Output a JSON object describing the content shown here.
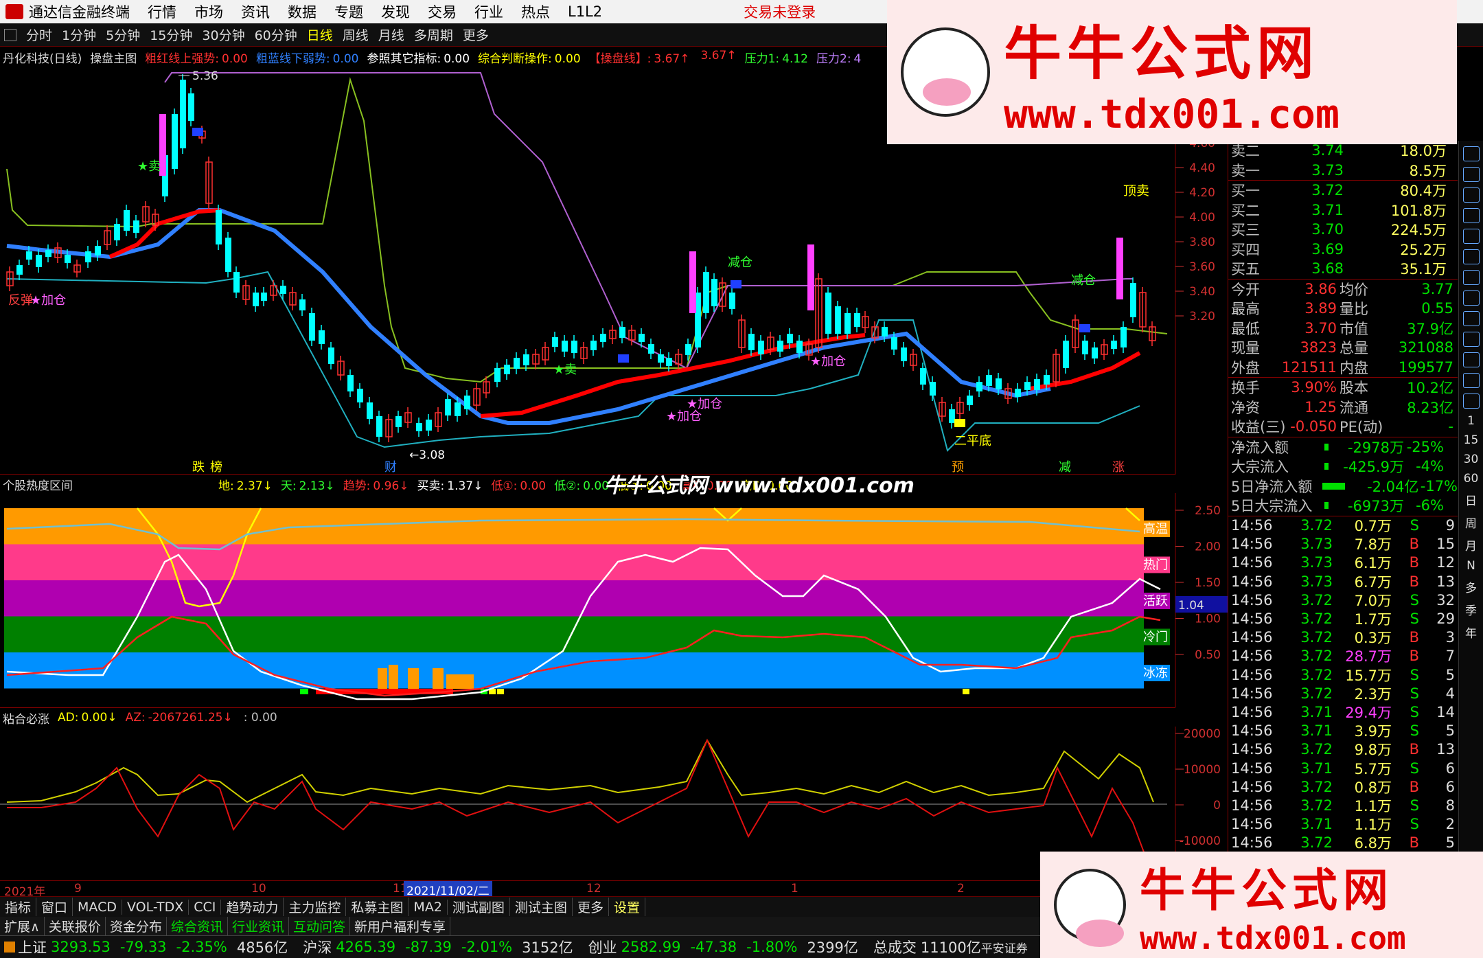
{
  "menu": {
    "app": "通达信金融终端",
    "items": [
      "行情",
      "市场",
      "资讯",
      "数据",
      "专题",
      "发现",
      "交易",
      "行业",
      "热点",
      "L1L2"
    ],
    "login": "交易未登录"
  },
  "periods": {
    "items": [
      "分时",
      "1分钟",
      "5分钟",
      "15分钟",
      "30分钟",
      "60分钟",
      "日线",
      "周线",
      "月线",
      "多周期",
      "更多"
    ],
    "active": "日线"
  },
  "main": {
    "stock": "丹化科技(日线)",
    "indicator": "操盘主图",
    "params": [
      {
        "k": "粗红线上强势:",
        "v": "0.00",
        "c": "#ff3030"
      },
      {
        "k": "粗蓝线下弱势:",
        "v": "0.00",
        "c": "#3080ff"
      },
      {
        "k": "参照其它指标:",
        "v": "0.00",
        "c": "#ffffff"
      },
      {
        "k": "综合判断操作:",
        "v": "0.00",
        "c": "#ffff00"
      },
      {
        "k": "【操盘线】:",
        "v": "3.67↑",
        "c": "#ff3030"
      },
      {
        "k": "",
        "v": "3.67↑",
        "c": "#ff3030"
      },
      {
        "k": "压力1:",
        "v": "4.12",
        "c": "#30ff30"
      },
      {
        "k": "压力2:",
        "v": "4",
        "c": "#c080ff"
      }
    ],
    "high_label": "5.36",
    "yaxis": [
      "4.80",
      "4.60",
      "4.40",
      "4.20",
      "4.00",
      "3.80",
      "3.60",
      "3.40",
      "3.20"
    ],
    "signals": [
      {
        "t": "反弹",
        "c": "#ff4040"
      },
      {
        "t": "★加仓",
        "c": "#ff60ff"
      },
      {
        "t": "★卖",
        "c": "#30ff30"
      },
      {
        "t": "减仓",
        "c": "#30ff30"
      },
      {
        "t": "★加仓",
        "c": "#ff60ff"
      },
      {
        "t": "★加仓",
        "c": "#ff60ff"
      },
      {
        "t": "★卖",
        "c": "#30ff30"
      },
      {
        "t": "★加仓",
        "c": "#ff60ff"
      },
      {
        "t": "减仓",
        "c": "#30ff30"
      },
      {
        "t": "顶卖",
        "c": "#ffff00"
      },
      {
        "t": "二平底",
        "c": "#ffff00"
      },
      {
        "t": "←3.08",
        "c": "#ffffff"
      }
    ],
    "bottom_tags": [
      {
        "t": "跌",
        "c": "#ffff00"
      },
      {
        "t": "榜",
        "c": "#ffff00"
      },
      {
        "t": "财",
        "c": "#3080ff"
      },
      {
        "t": "预",
        "c": "#ffa000"
      },
      {
        "t": "减",
        "c": "#30ff30"
      },
      {
        "t": "涨",
        "c": "#ff4040"
      }
    ]
  },
  "heat": {
    "title": "个股热度区间",
    "params": [
      {
        "k": "地:",
        "v": "2.37↓",
        "c": "#ffff00"
      },
      {
        "k": "天:",
        "v": "2.13↓",
        "c": "#30ff30"
      },
      {
        "k": "趋势:",
        "v": "0.96↓",
        "c": "#ff3030"
      },
      {
        "k": "买卖:",
        "v": "1.37↓",
        "c": "#ffffff"
      },
      {
        "k": "低①:",
        "v": "0.00",
        "c": "#ff3030"
      },
      {
        "k": "低②:",
        "v": "0.00",
        "c": "#30ff30"
      },
      {
        "k": "低③:",
        "v": "0.00",
        "c": "#ffff00"
      },
      {
        "k": "高A:",
        "v": "0.00",
        "c": "#ff3030"
      },
      {
        "k": "高B:",
        "v": "0.00",
        "c": "#ffff00"
      }
    ],
    "yaxis": [
      "2.50",
      "2.00",
      "1.50",
      "1.00",
      "0.50"
    ],
    "bands": [
      {
        "label": "高温",
        "color": "#ff9a00"
      },
      {
        "label": "热门",
        "color": "#ff3a8a"
      },
      {
        "label": "活跃",
        "color": "#b000b0"
      },
      {
        "label": "冷门",
        "color": "#008000"
      },
      {
        "label": "冰冻",
        "color": "#0090ff"
      }
    ],
    "current": "1.04"
  },
  "ad": {
    "title": "粘合必涨",
    "params": [
      {
        "k": "AD:",
        "v": "0.00↓",
        "c": "#ffff00"
      },
      {
        "k": "AZ:",
        "v": "-2067261.25↓",
        "c": "#ff3030"
      },
      {
        "k": "",
        "v": ": 0.00",
        "c": "#c0c0c0"
      }
    ],
    "yaxis": [
      "20000",
      "10000",
      "0",
      "-10000"
    ]
  },
  "dates": {
    "items": [
      "2021年",
      "9",
      "10",
      "11",
      "2021/11/02/二",
      "12",
      "1",
      "2"
    ]
  },
  "quote": {
    "asks": [
      {
        "l": "卖二",
        "p": "3.74",
        "v": "18.0万"
      },
      {
        "l": "卖一",
        "p": "3.73",
        "v": "8.5万"
      }
    ],
    "bids": [
      {
        "l": "买一",
        "p": "3.72",
        "v": "80.4万"
      },
      {
        "l": "买二",
        "p": "3.71",
        "v": "101.8万"
      },
      {
        "l": "买三",
        "p": "3.70",
        "v": "224.5万"
      },
      {
        "l": "买四",
        "p": "3.69",
        "v": "25.2万"
      },
      {
        "l": "买五",
        "p": "3.68",
        "v": "35.1万"
      }
    ],
    "stats": [
      [
        "今开",
        "3.86",
        "均价",
        "3.77"
      ],
      [
        "最高",
        "3.89",
        "量比",
        "0.55"
      ],
      [
        "最低",
        "3.70",
        "市值",
        "37.9亿"
      ],
      [
        "现量",
        "3823",
        "总量",
        "321088"
      ],
      [
        "外盘",
        "121511",
        "内盘",
        "199577"
      ]
    ],
    "stats2": [
      [
        "换手",
        "3.90%",
        "股本",
        "10.2亿"
      ],
      [
        "净资",
        "1.25",
        "流通",
        "8.23亿"
      ],
      [
        "收益(三)",
        "-0.050",
        "PE(动)",
        "-"
      ]
    ],
    "flows": [
      [
        "净流入额",
        "-2978万",
        "-25%"
      ],
      [
        "大宗流入",
        "-425.9万",
        "-4%"
      ],
      [
        "5日净流入额",
        "-2.04亿",
        "-17%"
      ],
      [
        "5日大宗流入",
        "-6973万",
        "-6%"
      ]
    ],
    "ticks": [
      [
        "14:56",
        "3.72",
        "0.7万",
        "S",
        "9"
      ],
      [
        "14:56",
        "3.73",
        "7.8万",
        "B",
        "15"
      ],
      [
        "14:56",
        "3.73",
        "6.1万",
        "B",
        "12"
      ],
      [
        "14:56",
        "3.73",
        "6.7万",
        "B",
        "13"
      ],
      [
        "14:56",
        "3.72",
        "7.0万",
        "S",
        "32"
      ],
      [
        "14:56",
        "3.72",
        "1.7万",
        "S",
        "29"
      ],
      [
        "14:56",
        "3.72",
        "0.3万",
        "B",
        "3"
      ],
      [
        "14:56",
        "3.72",
        "28.7万",
        "B",
        "7"
      ],
      [
        "14:56",
        "3.72",
        "15.7万",
        "S",
        "5"
      ],
      [
        "14:56",
        "3.72",
        "2.3万",
        "S",
        "4"
      ],
      [
        "14:56",
        "3.71",
        "29.4万",
        "S",
        "14"
      ],
      [
        "14:56",
        "3.71",
        "3.9万",
        "S",
        "5"
      ],
      [
        "14:56",
        "3.72",
        "9.8万",
        "B",
        "13"
      ],
      [
        "14:56",
        "3.71",
        "5.7万",
        "S",
        "6"
      ],
      [
        "14:56",
        "3.72",
        "0.8万",
        "B",
        "6"
      ],
      [
        "14:56",
        "3.72",
        "1.1万",
        "S",
        "8"
      ],
      [
        "14:56",
        "3.71",
        "1.1万",
        "S",
        "2"
      ],
      [
        "14:56",
        "3.72",
        "6.8万",
        "B",
        "5"
      ]
    ]
  },
  "sidebar": [
    "1",
    "15",
    "30",
    "60",
    "日",
    "周",
    "月",
    "N",
    "多",
    "季",
    "年"
  ],
  "tabs1": [
    "指标",
    "窗口",
    "MACD",
    "VOL-TDX",
    "CCI",
    "趋势动力",
    "主力监控",
    "私募主图",
    "MA2",
    "测试副图",
    "测试主图",
    "更多",
    "设置"
  ],
  "tabs2": [
    "扩展∧",
    "关联报价",
    "资金分布",
    "综合资讯",
    "行业资讯",
    "互动问答",
    "新用户福利专享"
  ],
  "status": [
    {
      "n": "上证",
      "v": "3293.53",
      "d": "-79.33",
      "p": "-2.35%",
      "a": "4856亿"
    },
    {
      "n": "沪深",
      "v": "4265.39",
      "d": "-87.39",
      "p": "-2.01%",
      "a": "3152亿"
    },
    {
      "n": "创业",
      "v": "2582.99",
      "d": "-47.38",
      "p": "-1.80%",
      "a": "2399亿"
    }
  ],
  "status_tail": {
    "k": "总成交",
    "v": "11100亿",
    "broker": "平安证券"
  },
  "watermark": {
    "cn": "牛牛公式网",
    "url": "www.tdx001.com",
    "mid": "牛牛公式网 www.tdx001.com"
  },
  "colors": {
    "up": "#ff3030",
    "down": "#00ffff",
    "ma_red": "#ff0000",
    "ma_blue": "#3080ff"
  }
}
